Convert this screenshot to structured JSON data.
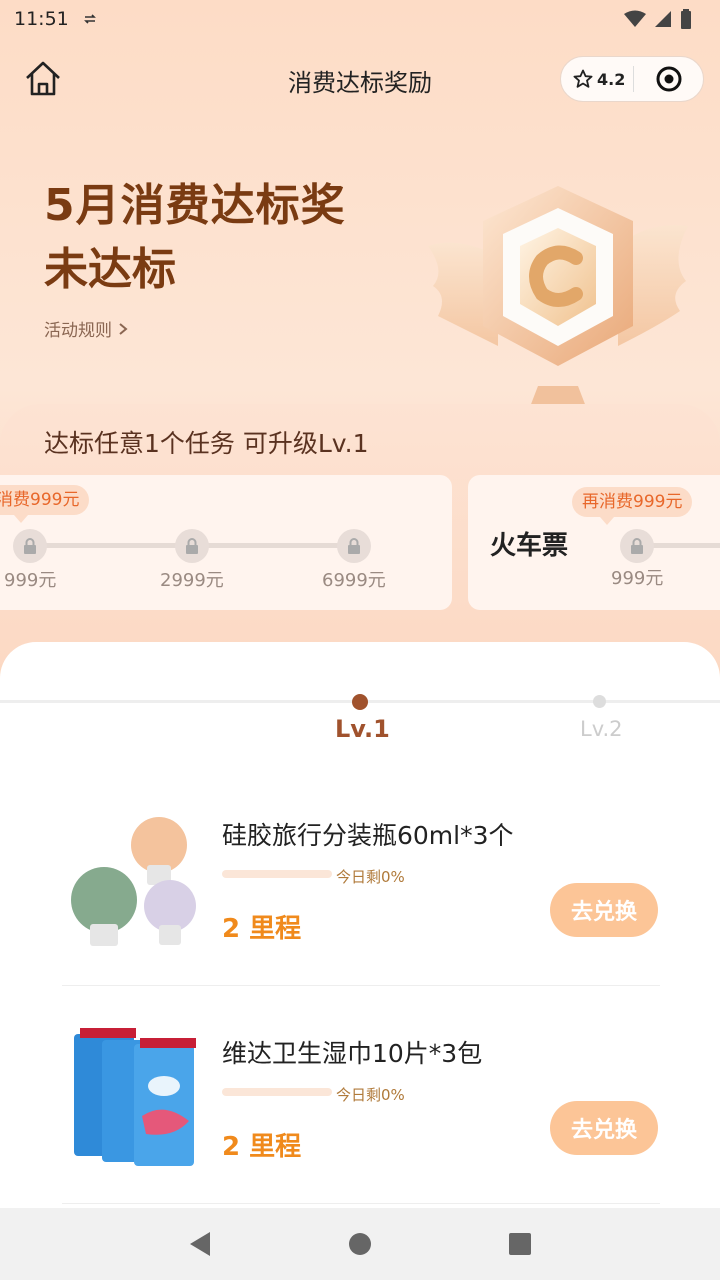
{
  "status_bar": {
    "time": "11:51"
  },
  "header": {
    "title": "消费达标奖励",
    "rating": "4.2"
  },
  "hero": {
    "title": "5月消费达标奖",
    "status": "未达标",
    "rules_link": "活动规则"
  },
  "tasks": {
    "heading": "达标任意1个任务 可升级Lv.1",
    "cards": [
      {
        "tip": "消费999元",
        "milestones": [
          "999元",
          "2999元",
          "6999元"
        ]
      },
      {
        "name": "火车票",
        "tip": "再消费999元",
        "milestones": [
          "999元"
        ]
      }
    ]
  },
  "levels": [
    {
      "label": "Lv.1",
      "active": true
    },
    {
      "label": "Lv.2",
      "active": false
    }
  ],
  "rewards": [
    {
      "name": "硅胶旅行分装瓶60ml*3个",
      "stock": "今日剩0%",
      "stock_fraction": 0,
      "price": "2 里程",
      "button": "去兑换"
    },
    {
      "name": "维达卫生湿巾10片*3包",
      "stock": "今日剩0%",
      "stock_fraction": 0,
      "price": "2 里程",
      "button": "去兑换"
    }
  ],
  "colors": {
    "accent": "#f08a1c",
    "hero_text": "#7a3b12",
    "button_bg": "#fcc597"
  }
}
